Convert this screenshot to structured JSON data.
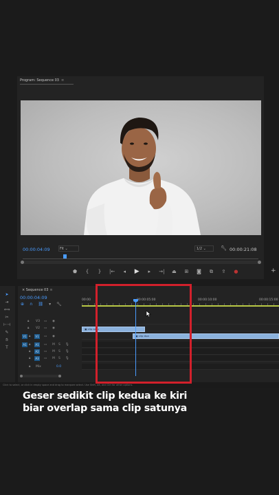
{
  "program_monitor": {
    "tab_label": "Program: Sequence 03",
    "tab_menu": "≡",
    "current_timecode": "00:00:04:09",
    "fit_label": "Fit",
    "resolution_label": "1/2",
    "duration_timecode": "00:00:21:08"
  },
  "timeline": {
    "tab_label": "Sequence 03",
    "tab_menu": "≡",
    "timecode": "00:00:04:09",
    "ruler_ticks": [
      "00:00",
      "00:00:05:00",
      "00:00:10:00",
      "00:00:15:00"
    ],
    "clips": [
      {
        "label": "clip satu"
      },
      {
        "label": "clip dua"
      }
    ],
    "video_tracks": [
      "V3",
      "V2",
      "V1"
    ],
    "audio_tracks": [
      "A1",
      "A2",
      "A3"
    ],
    "source_patch_v": "V1",
    "source_patch_a": "A1",
    "mix_label": "Mix",
    "mix_value": "0.0",
    "mute_label": "M",
    "solo_label": "S"
  },
  "status_bar": {
    "text": "Click to select, or click in empty space and drag to marquee select. Use Shift, Alt, and Ctrl for other options."
  },
  "caption": {
    "line1": "Geser sedikit clip kedua ke kiri",
    "line2": "biar overlap sama clip satunya"
  },
  "colors": {
    "accent": "#4a9cff",
    "clip": "#8cb2dd",
    "highlight": "#d2202b",
    "work_area": "#b8c845"
  }
}
